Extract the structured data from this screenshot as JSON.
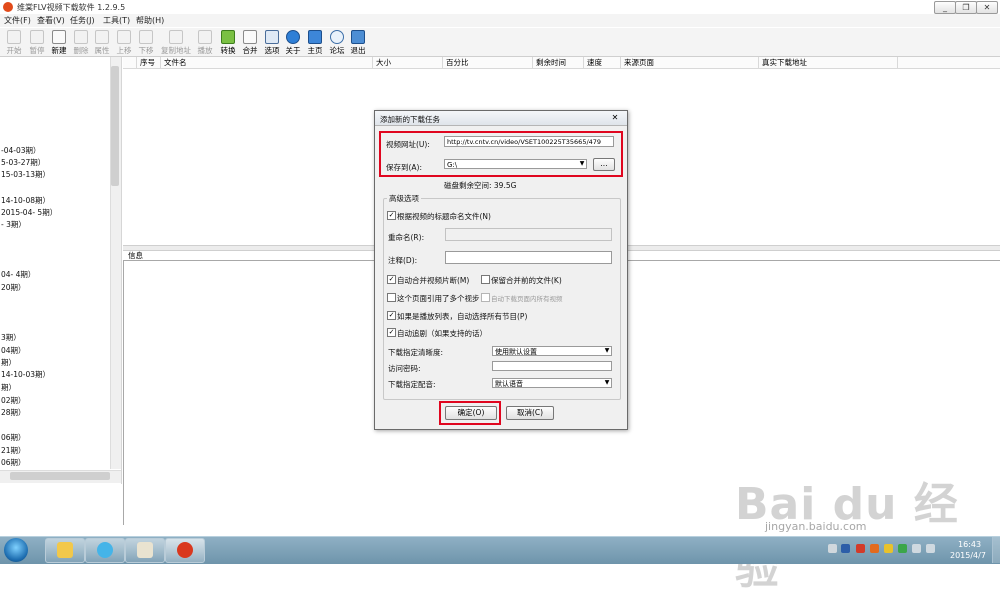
{
  "app": {
    "title": "维棠FLV视频下载软件 1.2.9.5",
    "window_buttons": [
      "_",
      "❐",
      "✕"
    ]
  },
  "menu": [
    "文件(F)",
    "查看(V)",
    "任务(J)",
    "工具(T)",
    "帮助(H)"
  ],
  "toolbar": [
    {
      "label": "开始",
      "icon": "play-icon",
      "enabled": false
    },
    {
      "label": "暂停",
      "icon": "pause-icon",
      "enabled": false
    },
    {
      "label": "新建",
      "icon": "new-file-icon",
      "enabled": true
    },
    {
      "label": "删除",
      "icon": "delete-icon",
      "enabled": false
    },
    {
      "label": "属性",
      "icon": "properties-icon",
      "enabled": false
    },
    {
      "label": "上移",
      "icon": "move-up-icon",
      "enabled": false
    },
    {
      "label": "下移",
      "icon": "move-down-icon",
      "enabled": false
    },
    {
      "label": "复制地址",
      "icon": "copy-url-icon",
      "enabled": false
    },
    {
      "label": "播放",
      "icon": "play-file-icon",
      "enabled": false
    },
    {
      "label": "转换",
      "icon": "convert-icon",
      "enabled": true
    },
    {
      "label": "合并",
      "icon": "merge-icon",
      "enabled": true
    },
    {
      "label": "选项",
      "icon": "options-icon",
      "enabled": true
    },
    {
      "label": "关于",
      "icon": "about-icon",
      "enabled": true
    },
    {
      "label": "主页",
      "icon": "home-icon",
      "enabled": true
    },
    {
      "label": "论坛",
      "icon": "forum-icon",
      "enabled": true
    },
    {
      "label": "退出",
      "icon": "exit-icon",
      "enabled": true
    }
  ],
  "left_panel": {
    "items": [
      "-04-03期）",
      "5-03-27期）",
      "15-03-13期）",
      "14-10-08期）",
      "2015-04- 5期）",
      "- 3期）",
      "04- 4期）",
      "20期）",
      "3期）",
      "04期）",
      "期）",
      "14-10-03期）",
      "期）",
      "02期）",
      "28期）",
      "06期）",
      "21期）",
      "06期）"
    ]
  },
  "list": {
    "columns": [
      "序号",
      "文件名",
      "大小",
      "百分比",
      "剩余时间",
      "速度",
      "来源页面",
      "真实下载地址"
    ]
  },
  "info_panel": {
    "label": "信息"
  },
  "dialog": {
    "title": "添加新的下载任务",
    "close": "✕",
    "video_url_label": "视频网址(U):",
    "video_url_value": "http://tv.cntv.cn/video/VSET100225T35665/479",
    "save_to_label": "保存到(A):",
    "save_to_value": "G:\\",
    "browse_label": "...",
    "disk_space": "磁盘剩余空间: 39.5G",
    "advanced_group": "高级选项",
    "opt_title_name": "根据视频的标题命名文件(N)",
    "rename_label": "重命名(R):",
    "rename_value": "",
    "comment_label": "注释(D):",
    "comment_value": "",
    "opt_auto_merge": "自动合并视频片断(M)",
    "opt_keep_before_merge": "保留合并前的文件(K)",
    "opt_multi_video": "这个页面引用了多个视步",
    "opt_download_all": "自动下载页面内所有视频",
    "opt_playlist": "如果是播放列表，自动选择所有节目(P)",
    "opt_auto_track": "自动追剧（如果支持的话）",
    "clarity_label": "下载指定清晰度:",
    "clarity_value": "使用默认设置",
    "password_label": "访问密码:",
    "password_value": "",
    "dubbing_label": "下载指定配音:",
    "dubbing_value": "默认语音",
    "ok_label": "确定(O)",
    "cancel_label": "取消(C)",
    "checks": {
      "title_name": true,
      "auto_merge": true,
      "keep_before_merge": false,
      "multi_video": false,
      "download_all": false,
      "playlist": true,
      "auto_track": true
    }
  },
  "watermark": {
    "logo": "Bai du 经验",
    "url": "jingyan.baidu.com"
  },
  "taskbar": {
    "apps": [
      "file-explorer-icon",
      "internet-explorer-icon",
      "paint-icon",
      "flv-downloader-icon"
    ],
    "time": "16:43",
    "date": "2015/4/7"
  },
  "colors": {
    "highlight": "#e0061f",
    "taskbar": "#7fa3b9"
  }
}
